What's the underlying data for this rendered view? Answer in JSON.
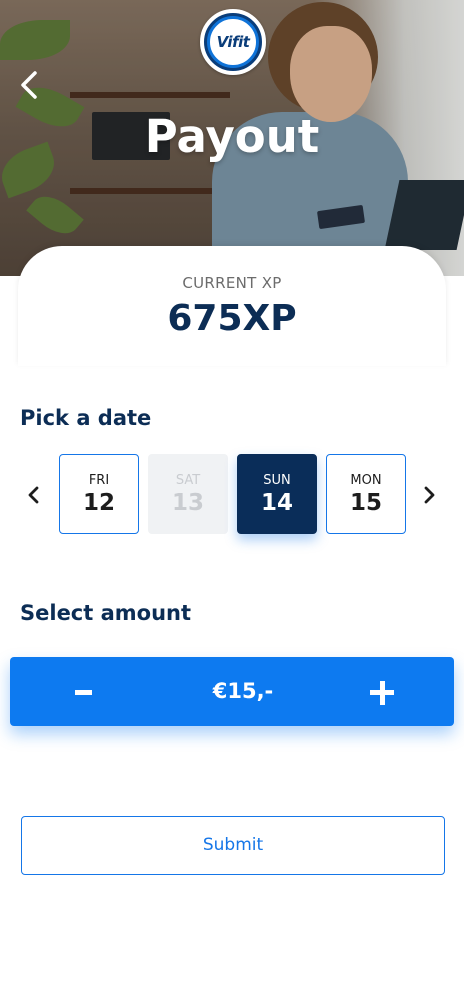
{
  "header": {
    "title": "Payout",
    "logo_text": "Vifit",
    "back_icon": "chevron-left-icon"
  },
  "xp": {
    "label": "CURRENT XP",
    "value": "675XP"
  },
  "date_picker": {
    "title": "Pick a date",
    "prev_icon": "chevron-left-icon",
    "next_icon": "chevron-right-icon",
    "dates": [
      {
        "day": "FRI",
        "date": "12",
        "state": "available"
      },
      {
        "day": "SAT",
        "date": "13",
        "state": "disabled"
      },
      {
        "day": "SUN",
        "date": "14",
        "state": "selected"
      },
      {
        "day": "MON",
        "date": "15",
        "state": "available"
      }
    ]
  },
  "amount": {
    "title": "Select amount",
    "value": "€15,-",
    "decrement_icon": "minus-icon",
    "increment_icon": "plus-icon"
  },
  "submit": {
    "label": "Submit"
  },
  "colors": {
    "brand_dark": "#0c2d55",
    "accent_blue": "#0d7af0",
    "outline_blue": "#1576e8",
    "disabled_bg": "#f0f2f4"
  }
}
